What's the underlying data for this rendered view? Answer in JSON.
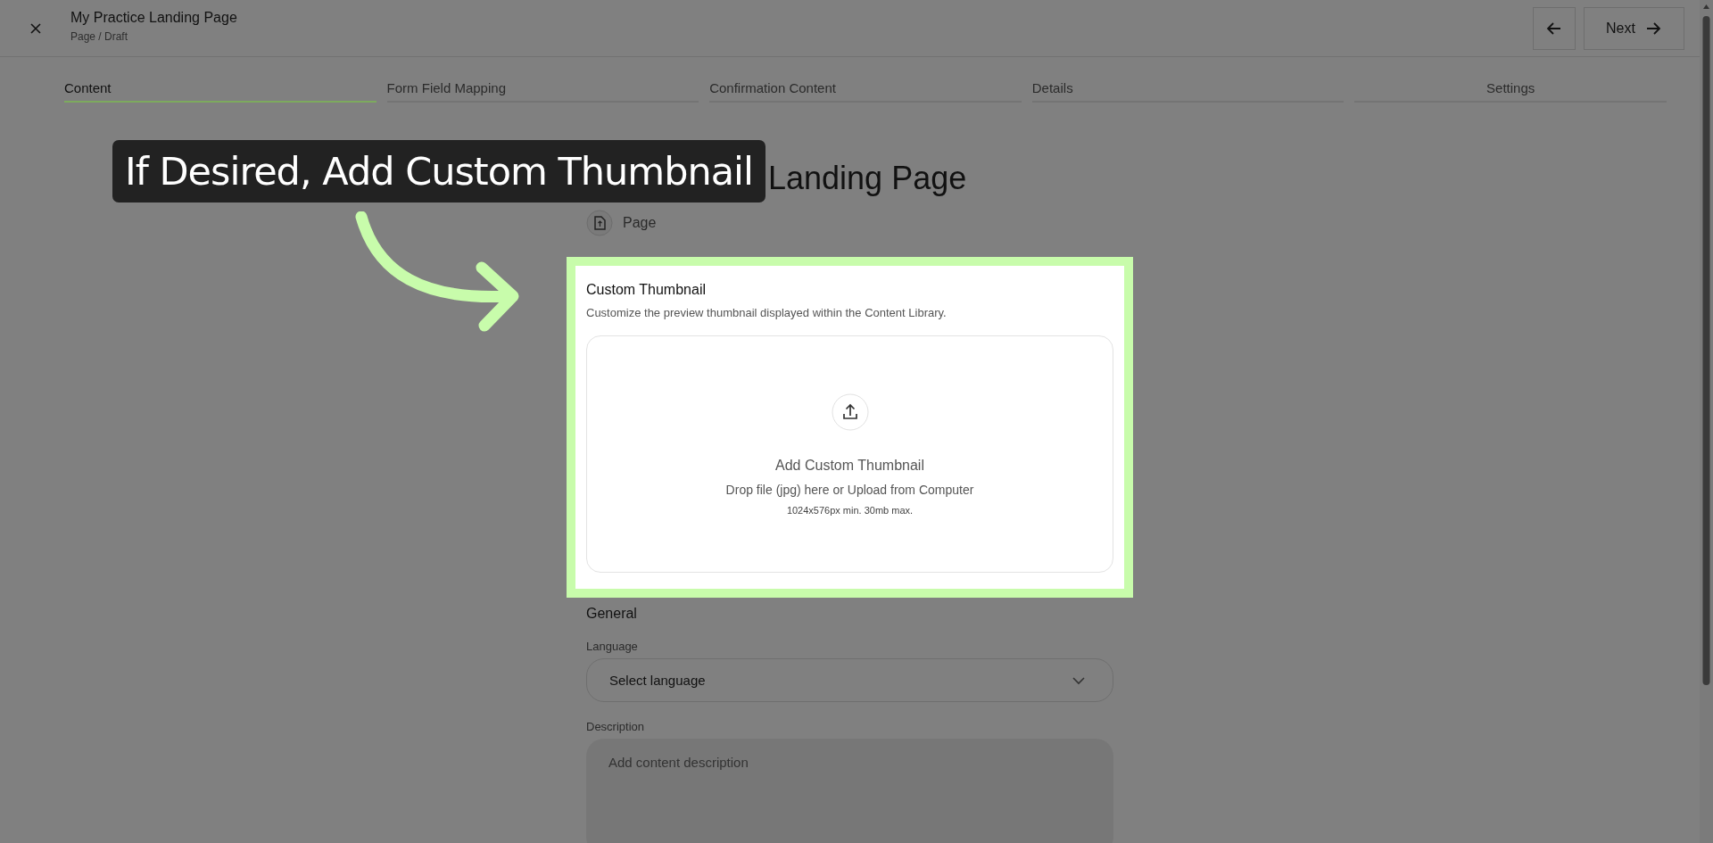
{
  "top_bar": {
    "title": "My Practice Landing Page",
    "subtitle": "Page / Draft",
    "next_label": "Next"
  },
  "tabs": [
    {
      "label": "Content",
      "selected": true
    },
    {
      "label": "Form Field Mapping",
      "selected": false
    },
    {
      "label": "Confirmation Content",
      "selected": false
    },
    {
      "label": "Details",
      "selected": false
    },
    {
      "label": "Settings",
      "selected": false
    }
  ],
  "callout": {
    "text": "If Desired, Add Custom Thumbnail"
  },
  "page_heading": "Landing Page",
  "content_type": "Page",
  "thumbnail_section": {
    "title": "Custom Thumbnail",
    "description": "Customize the preview thumbnail displayed within the Content Library.",
    "upload": {
      "title": "Add Custom Thumbnail",
      "hint": "Drop file (jpg) here or Upload from Computer",
      "limits": "1024x576px min. 30mb max."
    }
  },
  "general": {
    "title": "General",
    "fields": [
      {
        "kind": "select",
        "label": "Language",
        "value": "Select language"
      },
      {
        "kind": "textarea",
        "label": "Description",
        "placeholder": "Add content description"
      }
    ]
  }
}
